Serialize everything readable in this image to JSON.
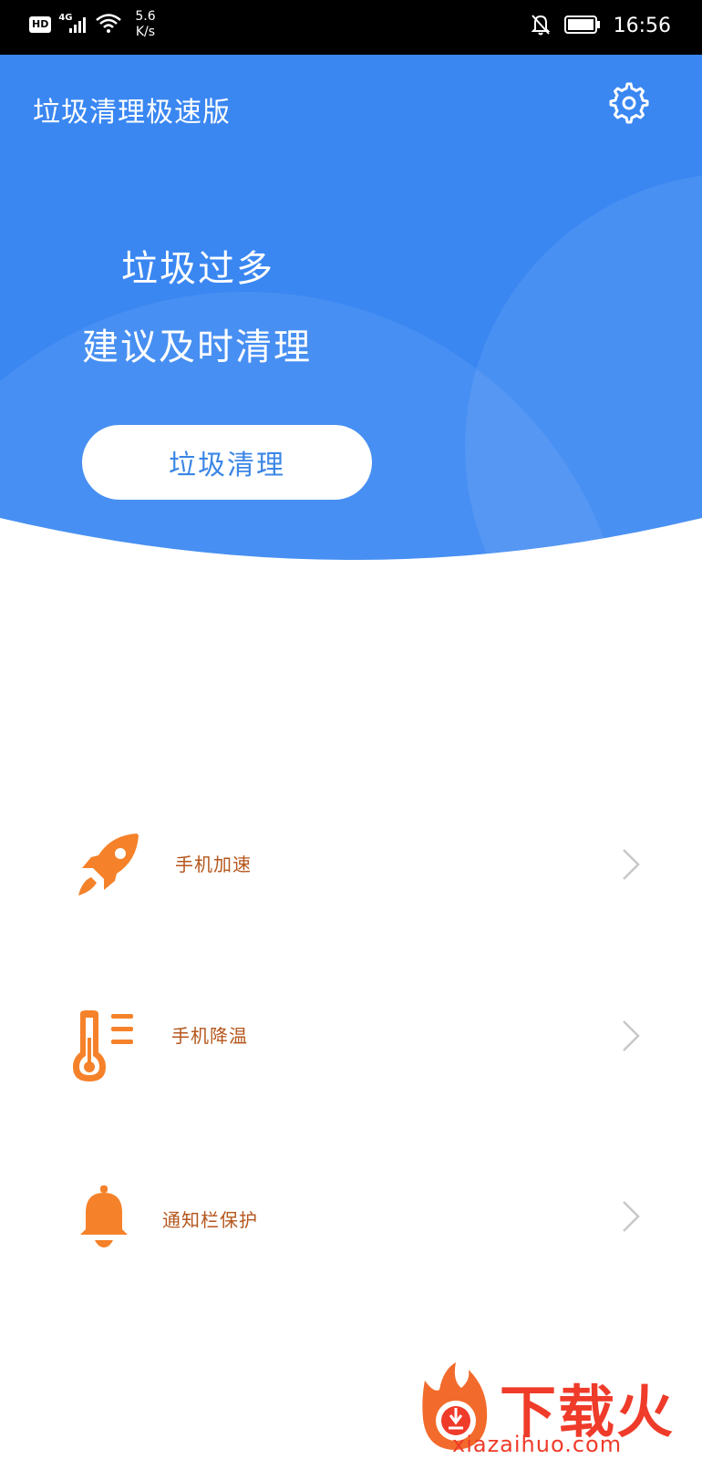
{
  "status_bar": {
    "hd": "HD",
    "network": "4G",
    "speed_value": "5.6",
    "speed_unit": "K/s",
    "time": "16:56"
  },
  "header": {
    "app_title": "垃圾清理极速版",
    "settings_icon": "gear-icon"
  },
  "hero": {
    "line1": "垃圾过多",
    "line2": "建议及时清理",
    "button_label": "垃圾清理",
    "colors": {
      "primary": "#3b86f0",
      "button_text": "#3b86e6"
    }
  },
  "features": [
    {
      "label": "手机加速",
      "icon": "rocket-icon"
    },
    {
      "label": "手机降温",
      "icon": "thermometer-icon"
    },
    {
      "label": "通知栏保护",
      "icon": "bell-icon"
    }
  ],
  "accent_color": "#f5822a",
  "watermark": {
    "text": "下载火",
    "url": "xiazaihuo.com"
  }
}
